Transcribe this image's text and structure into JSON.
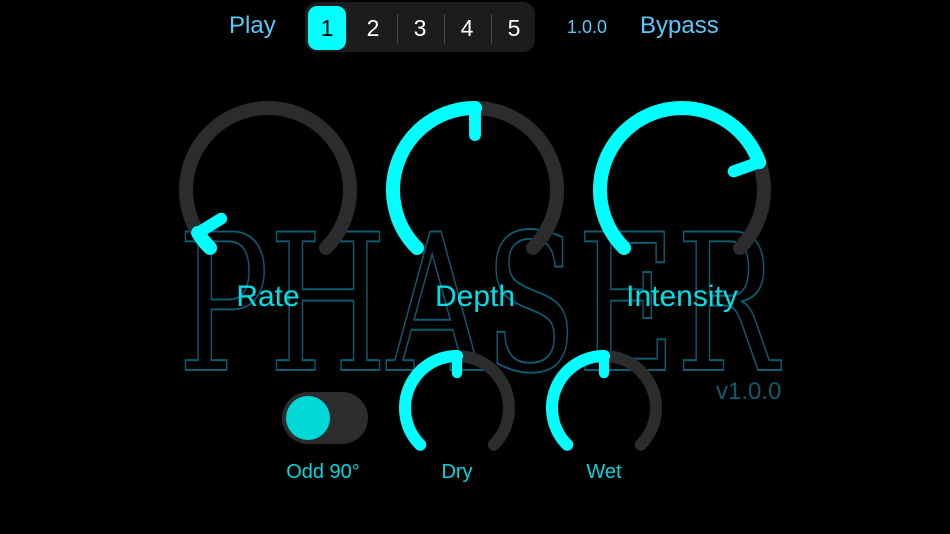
{
  "header": {
    "play_label": "Play",
    "presets": [
      "1",
      "2",
      "3",
      "4",
      "5"
    ],
    "selected_preset": "1",
    "version": "1.0.0",
    "bypass_label": "Bypass"
  },
  "logo": {
    "text": "PHASER",
    "version": "v1.0.0"
  },
  "knobs": [
    {
      "label": "Rate",
      "value": 0.05
    },
    {
      "label": "Depth",
      "value": 0.5
    },
    {
      "label": "Intensity",
      "value": 0.76
    },
    {
      "label": "Dry",
      "value": 0.5
    },
    {
      "label": "Wet",
      "value": 0.5
    }
  ],
  "toggle": {
    "label": "Odd 90°",
    "on": true
  },
  "colors": {
    "accent": "#00ffff",
    "track": "#2c2c2e",
    "logo_stroke": "#0e5a6e",
    "link": "#5ac8fa"
  }
}
